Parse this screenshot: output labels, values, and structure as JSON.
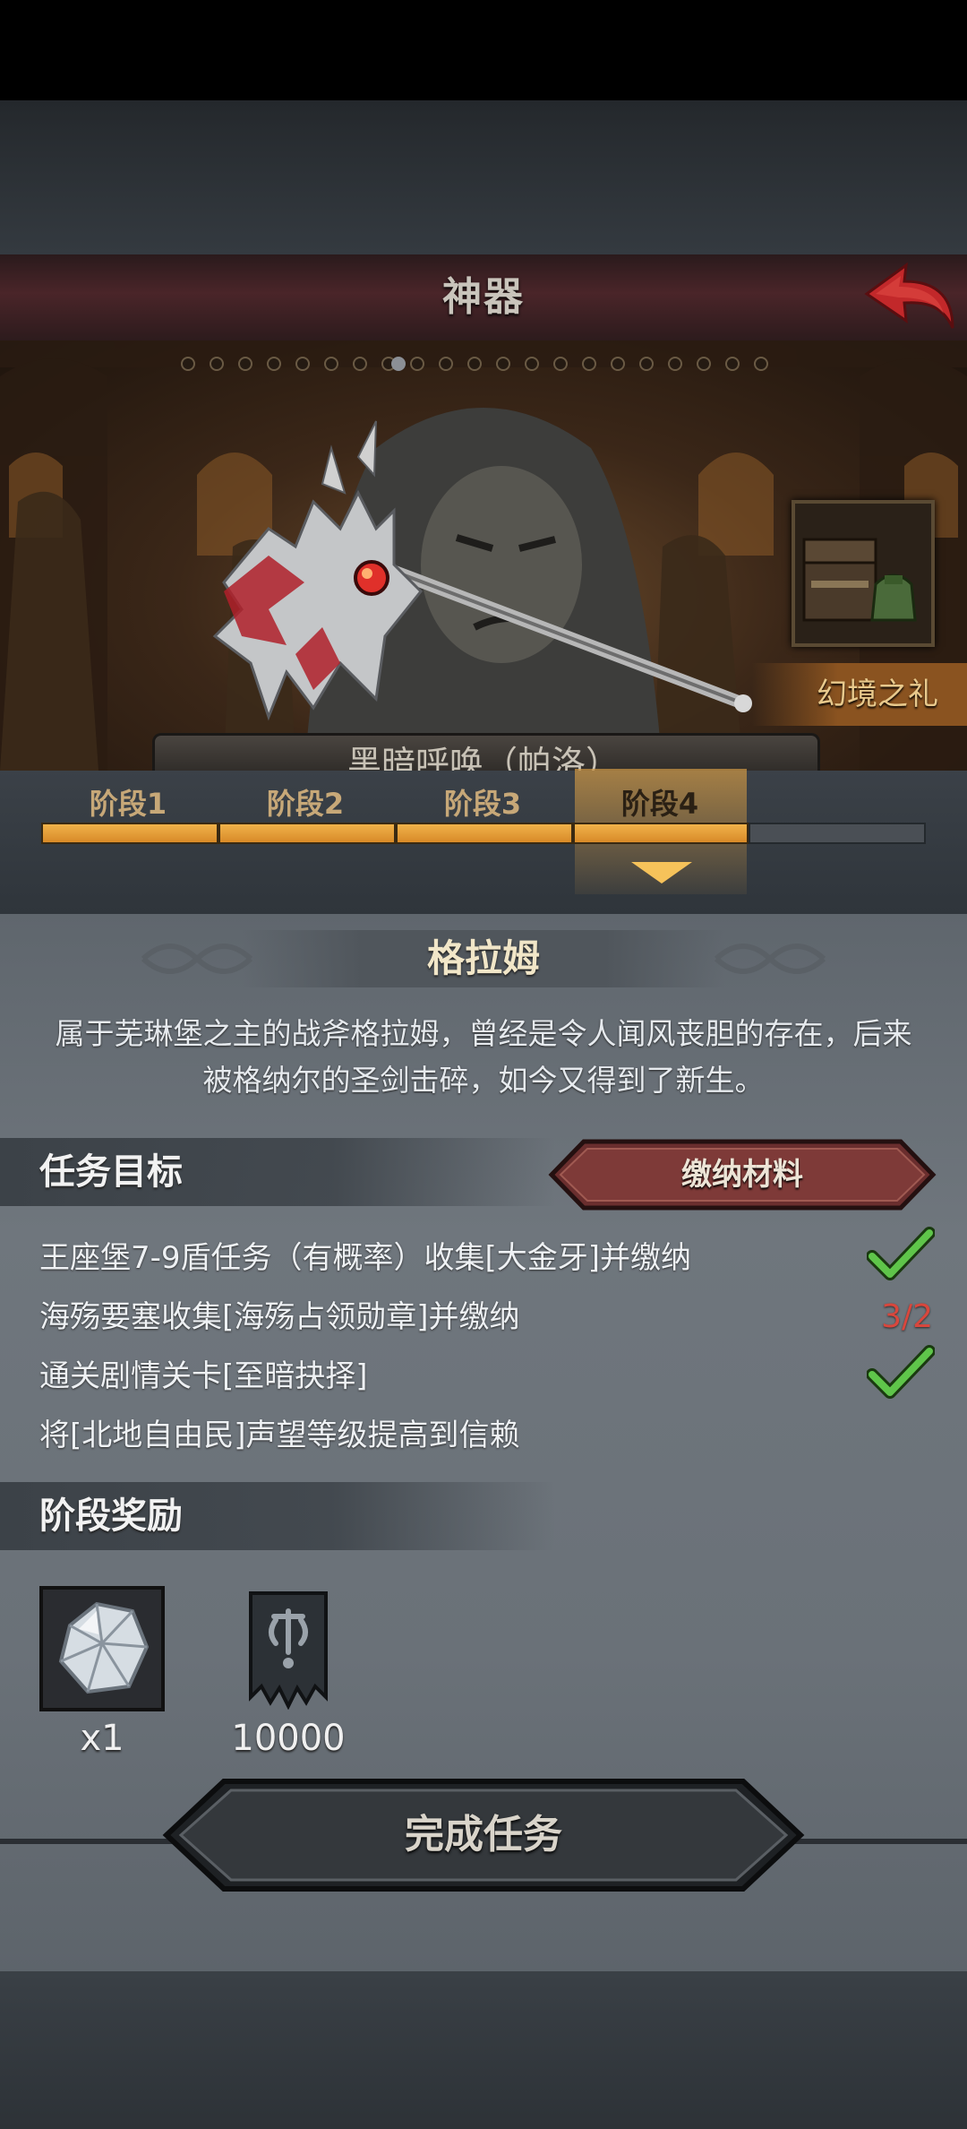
{
  "header": {
    "title": "神器"
  },
  "hero": {
    "gift_label": "幻境之礼",
    "subtitle": "黑暗呼唤（帕洛）"
  },
  "stages": {
    "labels": [
      "阶段1",
      "阶段2",
      "阶段3",
      "阶段4"
    ],
    "current_index": 3,
    "completed_segments": 4,
    "total_segments": 5
  },
  "artifact": {
    "name": "格拉姆",
    "description_line1": "属于芜琳堡之主的战斧格拉姆，曾经是令人闻风丧胆的存在，后来",
    "description_line2": "被格纳尔的圣剑击碎，如今又得到了新生。"
  },
  "tasks": {
    "section_title": "任务目标",
    "submit_button": "缴纳材料",
    "items": [
      {
        "text": "王座堡7-9盾任务（有概率）收集[大金牙]并缴纳",
        "status": "complete"
      },
      {
        "text": "海殇要塞收集[海殇占领勋章]并缴纳",
        "status": "progress",
        "progress": "3/2"
      },
      {
        "text": "通关剧情关卡[至暗抉择]",
        "status": "complete"
      },
      {
        "text": "将[北地自由民]声望等级提高到信赖",
        "status": "incomplete"
      }
    ]
  },
  "rewards": {
    "section_title": "阶段奖励",
    "items": [
      {
        "icon": "crystal-icon",
        "qty": "x1"
      },
      {
        "icon": "banner-icon",
        "qty": "10000"
      }
    ]
  },
  "footer": {
    "complete_button": "完成任务"
  },
  "colors": {
    "accent_orange": "#e8a23a",
    "check_green": "#5fc54a",
    "progress_red": "#d8473d",
    "title_bar": "#4a2529"
  }
}
